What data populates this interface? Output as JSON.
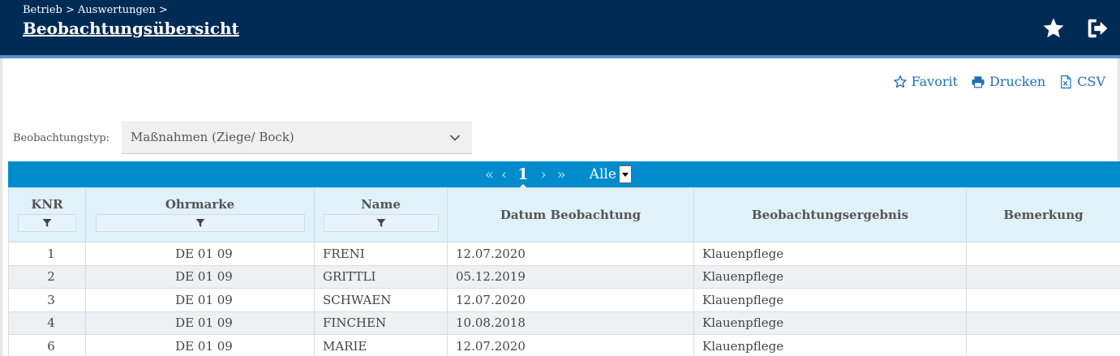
{
  "header": {
    "breadcrumb": "Betrieb > Auswertungen >",
    "title": "Beobachtungsübersicht",
    "icons": {
      "favorite": "star-icon",
      "logout": "logout-icon"
    }
  },
  "actions": {
    "favorite_label": "Favorit",
    "print_label": "Drucken",
    "csv_label": "CSV"
  },
  "filter": {
    "label": "Beobachtungstyp:",
    "selected": "Maßnahmen (Ziege/ Bock)"
  },
  "pager": {
    "current_page": "1",
    "page_size": "Alle"
  },
  "table": {
    "columns": {
      "knr": "KNR",
      "ohrmarke": "Ohrmarke",
      "name": "Name",
      "datum": "Datum Beobachtung",
      "ergebnis": "Beobachtungsergebnis",
      "bemerkung": "Bemerkung"
    },
    "rows": [
      {
        "knr": "1",
        "ohrmarke": "DE 01 09",
        "name": "FRENI",
        "datum": "12.07.2020",
        "ergebnis": "Klauenpflege",
        "bemerkung": ""
      },
      {
        "knr": "2",
        "ohrmarke": "DE 01 09",
        "name": "GRITTLI",
        "datum": "05.12.2019",
        "ergebnis": "Klauenpflege",
        "bemerkung": ""
      },
      {
        "knr": "3",
        "ohrmarke": "DE 01 09",
        "name": "SCHWAEN",
        "datum": "12.07.2020",
        "ergebnis": "Klauenpflege",
        "bemerkung": ""
      },
      {
        "knr": "4",
        "ohrmarke": "DE 01 09",
        "name": "FINCHEN",
        "datum": "10.08.2018",
        "ergebnis": "Klauenpflege",
        "bemerkung": ""
      },
      {
        "knr": "6",
        "ohrmarke": "DE 01 09",
        "name": "MARIE",
        "datum": "12.07.2020",
        "ergebnis": "Klauenpflege",
        "bemerkung": ""
      }
    ]
  },
  "colors": {
    "header_bg": "#002b55",
    "accent_blue": "#008ccc",
    "link_blue": "#1f6fb8",
    "table_header_bg": "#e0f1fa"
  }
}
